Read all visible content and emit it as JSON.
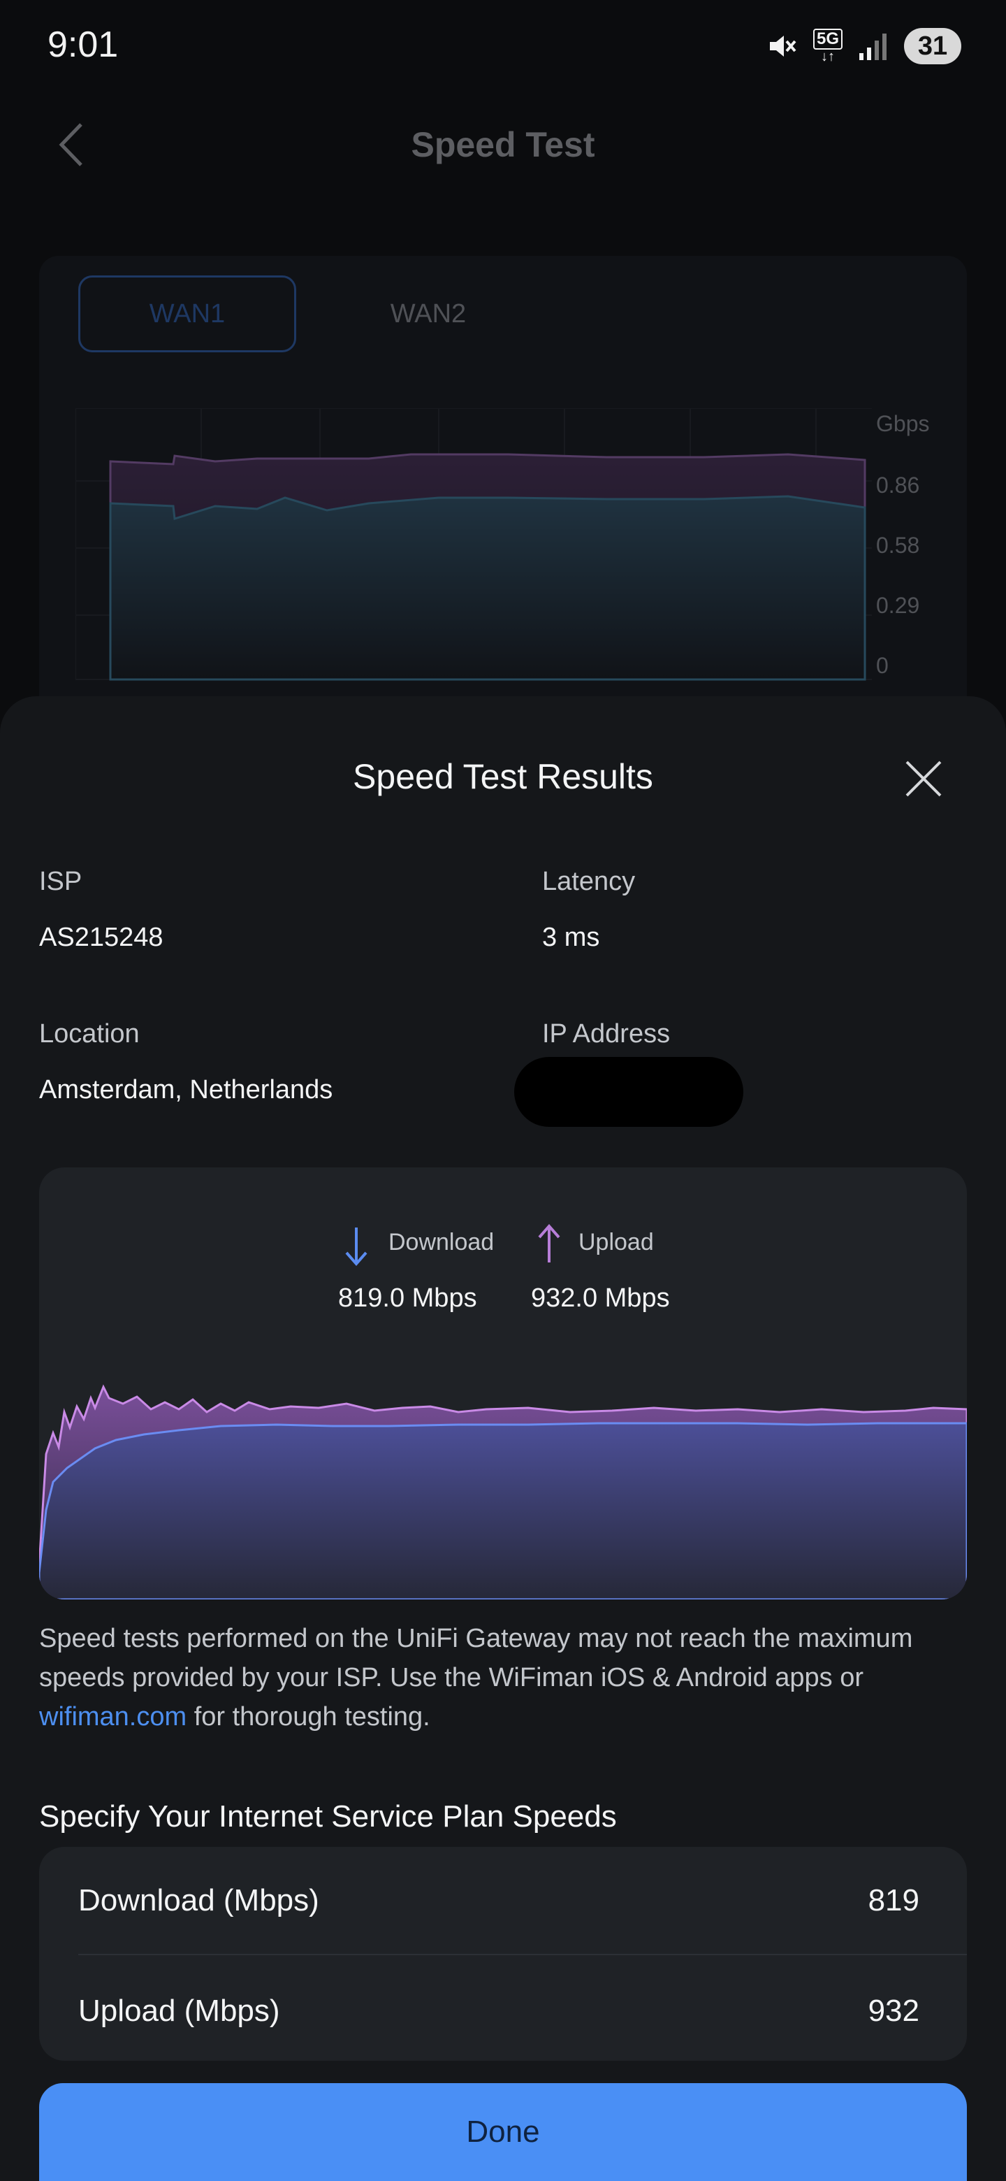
{
  "status_bar": {
    "time": "9:01",
    "network": "5G",
    "battery": "31"
  },
  "background": {
    "title": "Speed Test",
    "tabs": [
      "WAN1",
      "WAN2"
    ],
    "y_axis": {
      "unit": "Gbps",
      "ticks": [
        "0.86",
        "0.58",
        "0.29",
        "0"
      ]
    }
  },
  "sheet": {
    "title": "Speed Test Results",
    "isp_label": "ISP",
    "isp_value": "AS215248",
    "latency_label": "Latency",
    "latency_value": "3 ms",
    "location_label": "Location",
    "location_value": "Amsterdam, Netherlands",
    "ip_label": "IP Address"
  },
  "result_chart": {
    "download_label": "Download",
    "download_value": "819.0 Mbps",
    "upload_label": "Upload",
    "upload_value": "932.0 Mbps",
    "colors": {
      "download": "#5b8cf0",
      "upload": "#b77ed8"
    }
  },
  "disclaimer": {
    "text1": "Speed tests performed on the UniFi Gateway may not reach the maximum speeds provided by your ISP. Use the WiFiman iOS & Android apps or ",
    "link": "wifiman.com",
    "text2": " for thorough testing."
  },
  "plan": {
    "title": "Specify Your Internet Service Plan Speeds",
    "download_label": "Download (Mbps)",
    "download_value": "819",
    "upload_label": "Upload (Mbps)",
    "upload_value": "932"
  },
  "done_label": "Done"
}
